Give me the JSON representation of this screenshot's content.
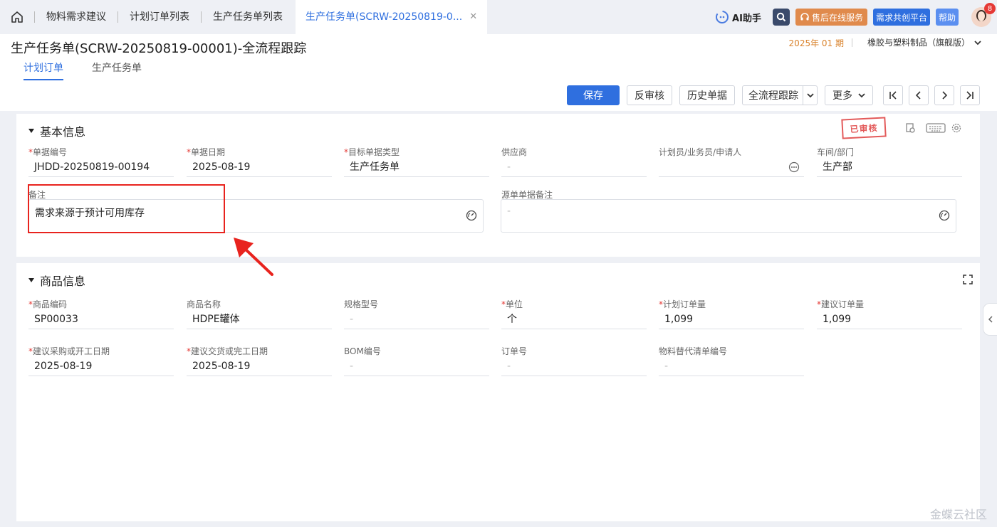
{
  "tabs": {
    "items": [
      "物料需求建议",
      "计划订单列表",
      "生产任务单列表"
    ],
    "active": "生产任务单(SCRW-20250819-0..."
  },
  "topright": {
    "ai_label": "AI助手",
    "service_label": "售后在线服务",
    "platform_label": "需求共创平台",
    "help_label": "帮助",
    "notif_count": "8"
  },
  "header": {
    "title": "生产任务单(SCRW-20250819-00001)-全流程跟踪",
    "period": "2025年 01 期",
    "org": "橡胶与塑料制品（旗舰版）",
    "subtabs": [
      "计划订单",
      "生产任务单"
    ]
  },
  "toolbar": {
    "save": "保存",
    "unaudit": "反审核",
    "history": "历史单据",
    "trace": "全流程跟踪",
    "more": "更多"
  },
  "basic": {
    "title": "基本信息",
    "stamp": "已审核",
    "fields": [
      {
        "label": "单据编号",
        "required": true,
        "value": "JHDD-20250819-00194"
      },
      {
        "label": "单据日期",
        "required": true,
        "value": "2025-08-19"
      },
      {
        "label": "目标单据类型",
        "required": true,
        "value": "生产任务单"
      },
      {
        "label": "供应商",
        "required": false,
        "value": "-"
      },
      {
        "label": "计划员/业务员/申请人",
        "required": false,
        "value": ""
      },
      {
        "label": "车间/部门",
        "required": false,
        "value": "生产部"
      }
    ],
    "remark_label": "备注",
    "remark_value": "需求来源于预计可用库存",
    "src_remark_label": "源单单据备注",
    "src_remark_value": "-"
  },
  "goods": {
    "title": "商品信息",
    "row1": [
      {
        "label": "商品编码",
        "required": true,
        "value": "SP00033"
      },
      {
        "label": "商品名称",
        "required": false,
        "value": "HDPE罐体"
      },
      {
        "label": "规格型号",
        "required": false,
        "value": "-"
      },
      {
        "label": "单位",
        "required": true,
        "value": "个"
      },
      {
        "label": "计划订单量",
        "required": true,
        "value": "1,099"
      },
      {
        "label": "建议订单量",
        "required": true,
        "value": "1,099"
      }
    ],
    "row2": [
      {
        "label": "建议采购或开工日期",
        "required": true,
        "value": "2025-08-19"
      },
      {
        "label": "建议交货或完工日期",
        "required": true,
        "value": "2025-08-19"
      },
      {
        "label": "BOM编号",
        "required": false,
        "value": "-"
      },
      {
        "label": "订单号",
        "required": false,
        "value": "-"
      },
      {
        "label": "物料替代清单编号",
        "required": false,
        "value": "-"
      }
    ]
  },
  "watermark": "金蝶云社区",
  "colors": {
    "primary": "#2f6fdf",
    "accent": "#e08a4c",
    "annotation": "#e8231e"
  }
}
